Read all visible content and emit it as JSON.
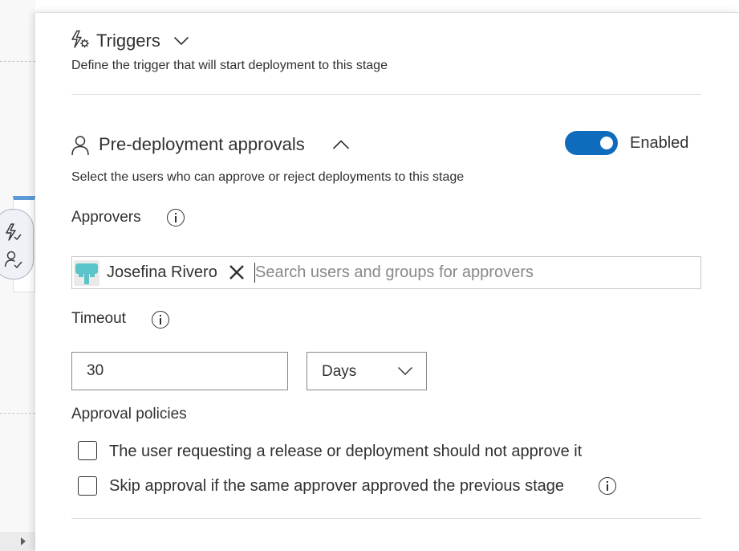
{
  "triggers": {
    "title": "Triggers",
    "description": "Define the trigger that will start deployment to this stage",
    "icon": "trigger-icon"
  },
  "approvals": {
    "title": "Pre-deployment approvals",
    "description": "Select the users who can approve or reject deployments to this stage",
    "toggle_label": "Enabled",
    "toggle_on": true,
    "accent": "#0f6cbd"
  },
  "approvers": {
    "label": "Approvers",
    "selected": [
      {
        "name": "Josefina Rivero",
        "avatar_color": "#5bc4c8"
      }
    ],
    "placeholder": "Search users and groups for approvers"
  },
  "timeout": {
    "label": "Timeout",
    "value": "30",
    "unit": "Days"
  },
  "policies": {
    "label": "Approval policies",
    "options": [
      {
        "label": "The user requesting a release or deployment should not approve it",
        "checked": false
      },
      {
        "label": "Skip approval if the same approver approved the previous stage",
        "checked": false
      }
    ]
  }
}
